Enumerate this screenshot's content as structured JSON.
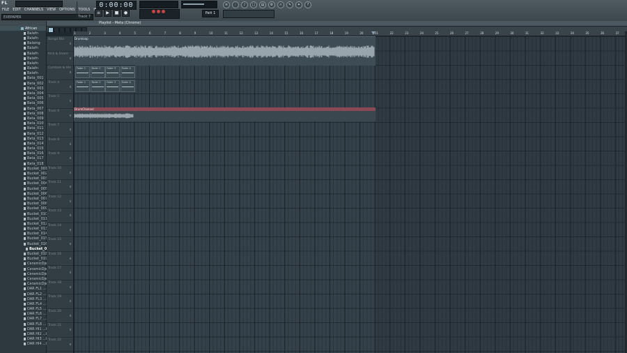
{
  "app": {
    "logo": "FL",
    "menu": [
      "FILE",
      "EDIT",
      "CHANNELS",
      "VIEW",
      "OPTIONS",
      "TOOLS",
      "HELP"
    ],
    "hint_left": "EXEPAPER",
    "hint_right": "Track 7",
    "clock": "0:00:00",
    "pattern_label": "Patt 1"
  },
  "transport": {
    "buttons": [
      "pattern-song-toggle",
      "play",
      "stop",
      "record",
      "pattern-mode"
    ]
  },
  "toolbar_icons": [
    "mixer-icon",
    "channel-rack-icon",
    "piano-roll-icon",
    "browser-icon",
    "playlist-icon",
    "plugin-icon",
    "help-icon",
    "magnet-icon",
    "stamp-icon",
    "settings-icon"
  ],
  "browser": {
    "items": [
      {
        "label": "African",
        "type": "folder"
      },
      {
        "label": "Balafn",
        "type": "file"
      },
      {
        "label": "Balafn",
        "type": "file"
      },
      {
        "label": "Balaing",
        "type": "file"
      },
      {
        "label": "Balafn",
        "type": "file"
      },
      {
        "label": "Balafn",
        "type": "file"
      },
      {
        "label": "Balafn",
        "type": "file"
      },
      {
        "label": "Balafn",
        "type": "file"
      },
      {
        "label": "Balafn",
        "type": "file"
      },
      {
        "label": "Balafn",
        "type": "file"
      },
      {
        "label": "Bata_001",
        "type": "file"
      },
      {
        "label": "Bata_002",
        "type": "file"
      },
      {
        "label": "Bata_003",
        "type": "file"
      },
      {
        "label": "Bata_004",
        "type": "file"
      },
      {
        "label": "Bata_005",
        "type": "file"
      },
      {
        "label": "Bata_006",
        "type": "file"
      },
      {
        "label": "Bata_007",
        "type": "file"
      },
      {
        "label": "Bata_008",
        "type": "file"
      },
      {
        "label": "Bata_009",
        "type": "file"
      },
      {
        "label": "Bata_010",
        "type": "file"
      },
      {
        "label": "Bata_011",
        "type": "file"
      },
      {
        "label": "Bata_012",
        "type": "file"
      },
      {
        "label": "Bata_013",
        "type": "file"
      },
      {
        "label": "Bata_014",
        "type": "file"
      },
      {
        "label": "Bata_015",
        "type": "file"
      },
      {
        "label": "Bata_016",
        "type": "file"
      },
      {
        "label": "Bata_017",
        "type": "file"
      },
      {
        "label": "Bata_018",
        "type": "file"
      },
      {
        "label": "Bucket_001",
        "type": "file"
      },
      {
        "label": "Bucket_002",
        "type": "file"
      },
      {
        "label": "Bucket_003",
        "type": "file"
      },
      {
        "label": "Bucket_004",
        "type": "file"
      },
      {
        "label": "Bucket_005",
        "type": "file"
      },
      {
        "label": "Bucket_006",
        "type": "file"
      },
      {
        "label": "Bucket_007",
        "type": "file"
      },
      {
        "label": "Bucket_008",
        "type": "file"
      },
      {
        "label": "Bucket_009",
        "type": "file"
      },
      {
        "label": "Bucket_010",
        "type": "file"
      },
      {
        "label": "Bucket_011",
        "type": "file"
      },
      {
        "label": "Bucket_012",
        "type": "file"
      },
      {
        "label": "Bucket_013",
        "type": "file"
      },
      {
        "label": "Bucket_014",
        "type": "file"
      },
      {
        "label": "Bucket_015",
        "type": "file"
      },
      {
        "label": "Bucket_016",
        "type": "file"
      },
      {
        "label": "Bucket_017",
        "type": "selected"
      },
      {
        "label": "Bucket_018",
        "type": "file"
      },
      {
        "label": "Bucket_019",
        "type": "file"
      },
      {
        "label": "CeramicDje...",
        "type": "file"
      },
      {
        "label": "CeramicDje...",
        "type": "file"
      },
      {
        "label": "CeramicDje...",
        "type": "file"
      },
      {
        "label": "CeramicDje...",
        "type": "file"
      },
      {
        "label": "CeramicDje...",
        "type": "file"
      },
      {
        "label": "DAR FL1 ...k",
        "type": "file"
      },
      {
        "label": "DAR FL2 ...k",
        "type": "file"
      },
      {
        "label": "DAR FL3 ...k",
        "type": "file"
      },
      {
        "label": "DAR FL4 ...k",
        "type": "file"
      },
      {
        "label": "DAR FL5 ...k",
        "type": "file"
      },
      {
        "label": "DAR FL6 ...k",
        "type": "file"
      },
      {
        "label": "DAR FL7 ...k",
        "type": "file"
      },
      {
        "label": "DAR FL8 ...k",
        "type": "file"
      },
      {
        "label": "DAR HI1 ...k",
        "type": "file"
      },
      {
        "label": "DAR HI2 ...k",
        "type": "file"
      },
      {
        "label": "DAR HI3 ...k",
        "type": "file"
      },
      {
        "label": "DAR HI4 ...k",
        "type": "file"
      }
    ]
  },
  "playlist": {
    "title": "Playlist - Meta (Chrome)",
    "ruler": [
      "1",
      "2",
      "3",
      "4",
      "5",
      "6",
      "7",
      "8",
      "9",
      "10",
      "11",
      "12",
      "13",
      "14",
      "15",
      "16",
      "17",
      "18",
      "19",
      "20",
      "21",
      "22",
      "23",
      "24",
      "25",
      "26",
      "27",
      "28",
      "29",
      "30",
      "31",
      "32",
      "33",
      "34",
      "35",
      "36",
      "37"
    ],
    "tracks": [
      "Bongo Bla",
      "Kick & Snare",
      "Cymbals & HH",
      "Track 4",
      "Track 5",
      "Track 6",
      "Track 7",
      "Track 8",
      "Track 9",
      "Track 10",
      "Track 11",
      "Track 12",
      "Track 13",
      "Track 14",
      "Track 15",
      "Track 16",
      "Track 17",
      "Track 18",
      "Track 19",
      "Track 20",
      "Track 21",
      "Track 22"
    ],
    "clips": {
      "drums": "Drumloop",
      "drum2": "DrumChannel",
      "auto": [
        "Fader 1",
        "Fader 2",
        "Fader 3",
        "Fader 4",
        "Fader 1",
        "Fader 2",
        "Fader 3",
        "Fader 4"
      ]
    }
  },
  "colors": {
    "clip_header": "#8a4a55",
    "waveform": "#d8e2e8",
    "grid_bg": "#34414a"
  }
}
